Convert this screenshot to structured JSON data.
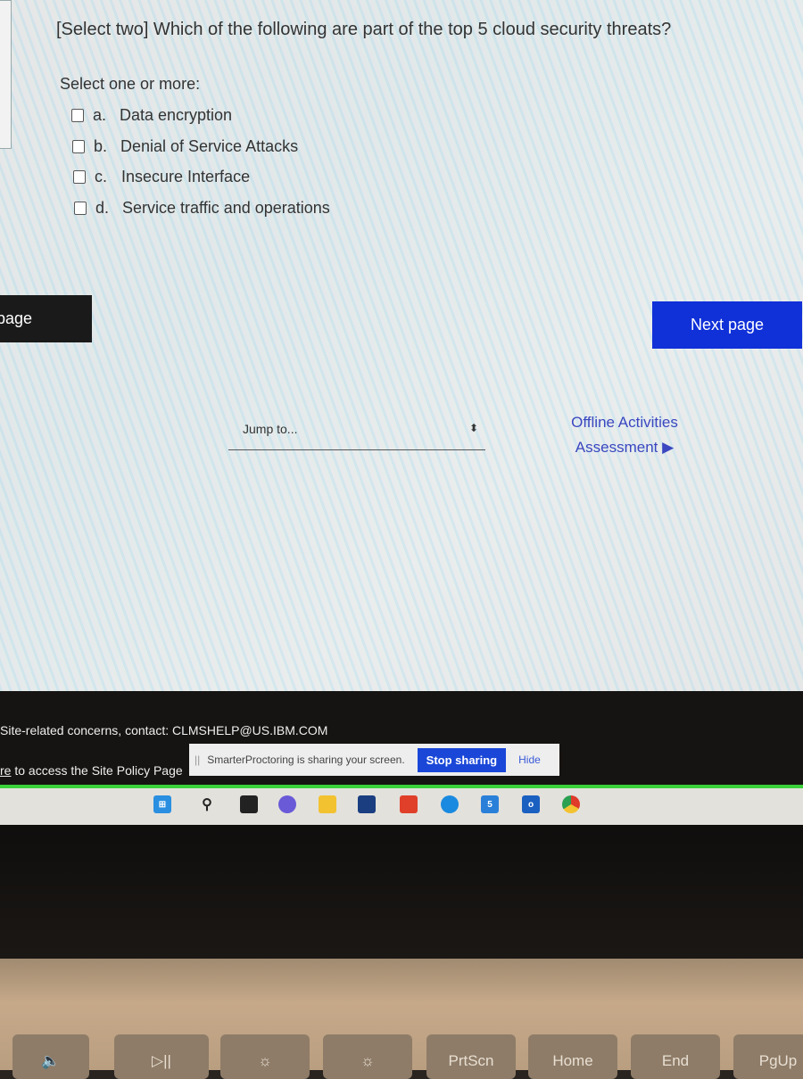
{
  "question": {
    "prompt": "[Select two] Which of the following are part of the top 5 cloud security threats?",
    "instruction": "Select one or more:",
    "options": [
      {
        "letter": "a.",
        "text": "Data encryption",
        "checked": false
      },
      {
        "letter": "b.",
        "text": "Denial of Service Attacks",
        "checked": false
      },
      {
        "letter": "c.",
        "text": "Insecure Interface",
        "checked": false
      },
      {
        "letter": "d.",
        "text": "Service traffic and operations",
        "checked": false
      }
    ]
  },
  "navigation": {
    "previous_label": "page",
    "next_label": "Next page",
    "jump_placeholder": "Jump to...",
    "jump_arrow": "▲▼",
    "next_activity_line1": "Offline Activities",
    "next_activity_line2": "Assessment ▶"
  },
  "footer": {
    "contact_text": "Site-related concerns, contact: CLMSHELP@US.IBM.COM",
    "policy_link": "re",
    "policy_text": " to access the Site Policy Page"
  },
  "share_bar": {
    "grip": "||",
    "message": "SmarterProctoring is sharing your screen.",
    "stop_label": "Stop sharing",
    "hide_label": "Hide"
  },
  "taskbar": {
    "icons": [
      "windows-start",
      "search",
      "task-view",
      "teams-chat",
      "file-explorer",
      "store",
      "office",
      "edge",
      "mail",
      "outlook",
      "chrome"
    ],
    "mail_badge": "5"
  },
  "keyboard": {
    "keys": [
      "🔈",
      "▷||",
      "☼",
      "☼",
      "PrtScn",
      "Home",
      "End",
      "PgUp"
    ]
  }
}
